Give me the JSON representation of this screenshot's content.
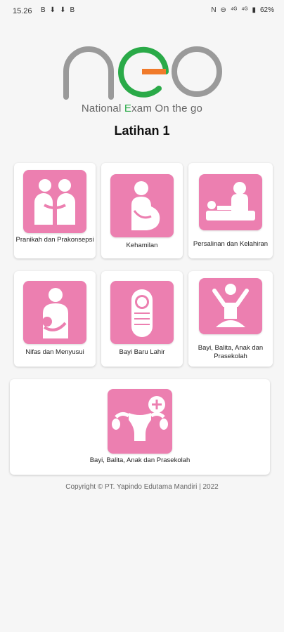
{
  "status_bar": {
    "time": "15.26",
    "notifications": [
      "B",
      "⬇",
      "⬇",
      "B"
    ],
    "system": [
      "N",
      "⊖",
      "⁴ᴳ",
      "⁴ᴳ",
      "▮",
      "62%"
    ]
  },
  "logo": {
    "word": "neo",
    "colors": {
      "gray": "#9a9a9a",
      "green": "#2aaa48",
      "orange": "#f07a2a"
    },
    "tagline_parts": [
      "National ",
      "E",
      "xam On the go"
    ]
  },
  "page_title": "Latihan 1",
  "accent_color": "#ec7fb0",
  "categories": [
    {
      "label": "Pranikah dan Prakonsepsi",
      "icon": "couple-icon"
    },
    {
      "label": "Kehamilan",
      "icon": "pregnancy-icon"
    },
    {
      "label": "Persalinan dan Kelahiran",
      "icon": "labor-icon"
    },
    {
      "label": "Nifas dan Menyusui",
      "icon": "breastfeeding-icon"
    },
    {
      "label": "Bayi Baru Lahir",
      "icon": "newborn-icon"
    },
    {
      "label": "Bayi, Balita, Anak dan Prasekolah",
      "icon": "child-icon"
    },
    {
      "label": "Bayi, Balita, Anak dan Prasekolah",
      "icon": "reproductive-health-icon"
    }
  ],
  "footer": {
    "copyright": "Copyright © PT. Yapindo Edutama Mandiri | 2022"
  }
}
